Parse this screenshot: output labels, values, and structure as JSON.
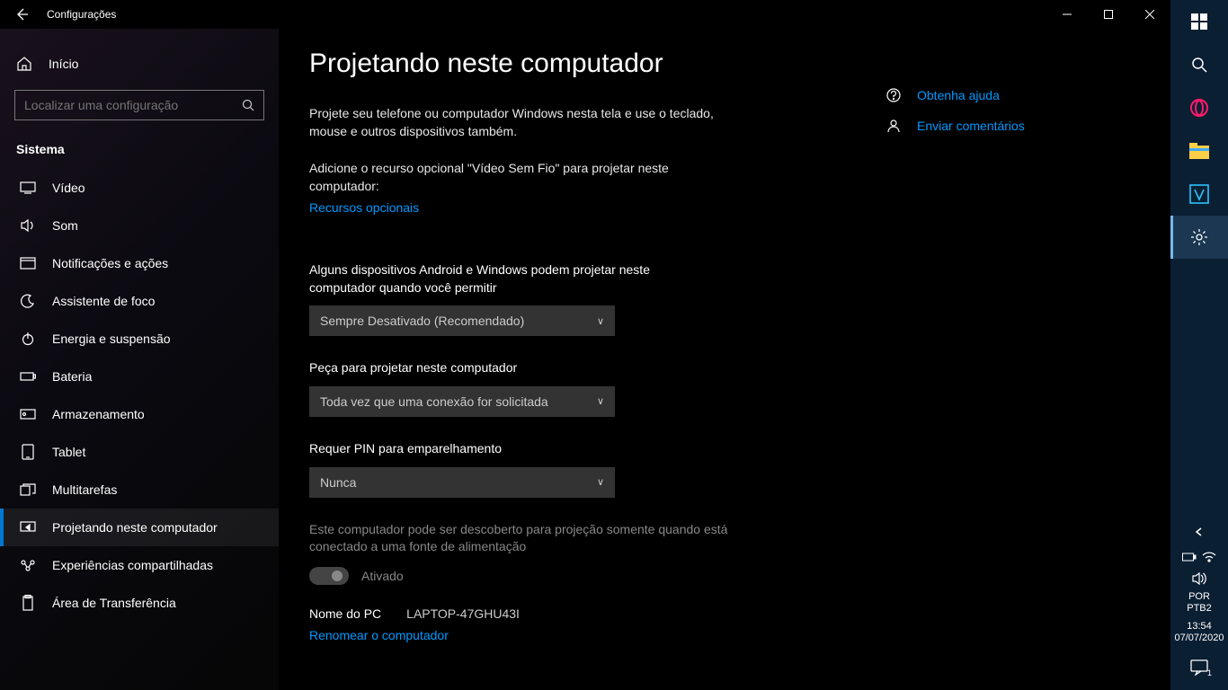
{
  "titlebar": {
    "title": "Configurações"
  },
  "sidebar": {
    "home": "Início",
    "search_placeholder": "Localizar uma configuração",
    "section": "Sistema",
    "items": [
      {
        "label": "Vídeo"
      },
      {
        "label": "Som"
      },
      {
        "label": "Notificações e ações"
      },
      {
        "label": "Assistente de foco"
      },
      {
        "label": "Energia e suspensão"
      },
      {
        "label": "Bateria"
      },
      {
        "label": "Armazenamento"
      },
      {
        "label": "Tablet"
      },
      {
        "label": "Multitarefas"
      },
      {
        "label": "Projetando neste computador"
      },
      {
        "label": "Experiências compartilhadas"
      },
      {
        "label": "Área de Transferência"
      }
    ]
  },
  "main": {
    "title": "Projetando neste computador",
    "intro": "Projete seu telefone ou computador Windows nesta tela e use o teclado, mouse e outros dispositivos também.",
    "feature_prompt": "Adicione o recurso opcional \"Vídeo Sem Fio\" para projetar neste computador:",
    "optional_features_link": "Recursos opcionais",
    "permit_label": "Alguns dispositivos Android e Windows podem projetar neste computador quando você permitir",
    "permit_value": "Sempre Desativado (Recomendado)",
    "ask_label": "Peça para projetar neste computador",
    "ask_value": "Toda vez que uma conexão for solicitada",
    "pin_label": "Requer PIN para emparelhamento",
    "pin_value": "Nunca",
    "power_note": "Este computador pode ser descoberto para projeção somente quando está conectado a uma fonte de alimentação",
    "toggle_state": "Ativado",
    "pc_name_label": "Nome do PC",
    "pc_name_value": "LAPTOP-47GHU43I",
    "rename_link": "Renomear o computador"
  },
  "rail": {
    "help": "Obtenha ajuda",
    "feedback": "Enviar comentários"
  },
  "taskbar": {
    "lang1": "POR",
    "lang2": "PTB2",
    "time": "13:54",
    "date": "07/07/2020",
    "notif_count": "1"
  }
}
